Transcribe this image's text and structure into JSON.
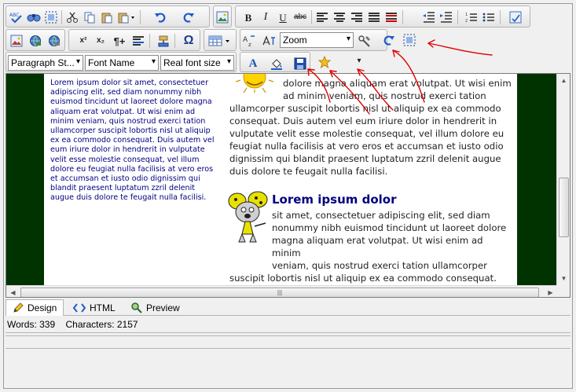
{
  "toolbar": {
    "row1_tools": [
      "spell-check",
      "find",
      "select-all",
      "cut",
      "copy",
      "paste",
      "paste-special",
      "undo",
      "redo",
      "image-insert",
      "bold",
      "italic",
      "underline",
      "strikethrough",
      "align-left",
      "align-center",
      "align-right",
      "justify",
      "clear-formatting",
      "outdent",
      "indent",
      "ordered-list",
      "unordered-list",
      "page-properties"
    ],
    "labels": {
      "bold": "B",
      "italic": "I",
      "underline": "U",
      "strikethrough": "abc",
      "superscript": "x²",
      "subscript": "x₂",
      "omega": "Ω",
      "text_color": "A"
    },
    "zoom": {
      "value": "Zoom"
    },
    "paragraph_style": {
      "value": "Paragraph St..."
    },
    "font_name": {
      "value": "Font Name"
    },
    "font_size": {
      "value": "Real font size"
    }
  },
  "content": {
    "left_text": "Lorem ipsum dolor sit amet, consectetuer adipiscing elit, sed diam nonummy nibh euismod tincidunt ut laoreet dolore magna aliquam erat volutpat. Ut wisi enim ad minim veniam, quis nostrud exerci tation ullamcorper suscipit lobortis nisl ut aliquip ex ea commodo consequat. Duis autem vel eum iriure dolor in hendrerit in vulputate velit esse molestie consequat, vel illum dolore eu feugiat nulla facilisis at vero eros et accumsan et iusto odio dignissim qui blandit praesent luptatum zzril delenit augue duis dolore te feugait nulla facilisi.",
    "para1_line1": "dolore magna aliquam erat volutpat. Ut wisi enim",
    "para1_line2": "ad minim veniam, quis nostrud exerci tation",
    "para1_rest": "ullamcorper suscipit lobortis nisl ut aliquip ex ea commodo consequat. Duis autem vel eum iriure dolor in hendrerit in vulputate velit esse molestie consequat, vel illum dolore eu feugiat nulla facilisis at vero eros et accumsan et iusto odio dignissim qui blandit praesent luptatum zzril delenit augue duis dolore te feugait nulla facilisi.",
    "heading2": "Lorem ipsum dolor",
    "para2_line1": "sit amet, consectetuer adipiscing elit, sed diam",
    "para2_line2": "nonummy nibh euismod tincidunt ut laoreet dolore",
    "para2_line3": "magna aliquam erat volutpat. Ut wisi enim ad minim",
    "para2_line4": "veniam, quis nostrud exerci tation ullamcorper",
    "para2_rest": "suscipit lobortis nisl ut aliquip ex ea commodo consequat. Duis autem vel eum iriure dolor in hendrerit in vulputate velit",
    "bg_color": "#003300",
    "text_color_left": "#000080",
    "heading_color": "#000080"
  },
  "modes": {
    "design": "Design",
    "html": "HTML",
    "preview": "Preview"
  },
  "status": {
    "words": "Words: 339",
    "characters": "Characters: 2157"
  },
  "annotation_color": "#e00000"
}
